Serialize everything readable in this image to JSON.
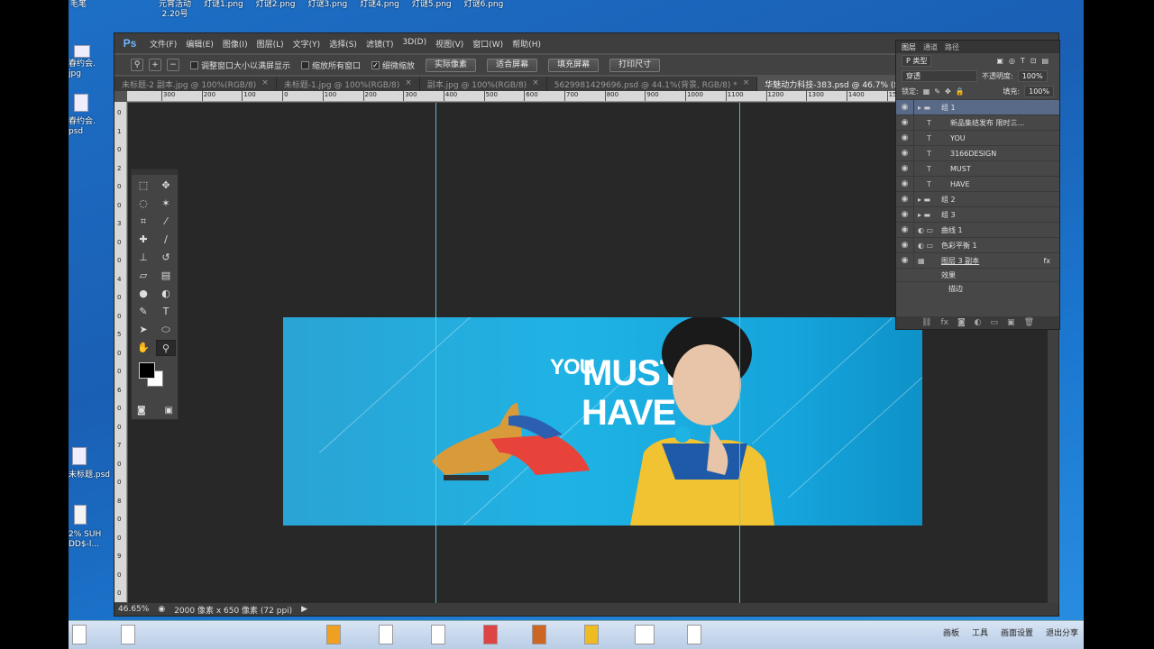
{
  "desktop": {
    "top_files": [
      "元宵活动\n2.20号",
      "灯谜1.png",
      "灯谜2.png",
      "灯谜3.png",
      "灯谜4.png",
      "灯谜5.png",
      "灯谜6.png"
    ],
    "left_labels": {
      "l1": "毛笔",
      "l2": "春约会.\njpg",
      "l3": "春约会.\npsd",
      "l4": "未标题.psd",
      "l5": "2% SUH\nDD$-l..."
    }
  },
  "ps": {
    "logo": "Ps",
    "menu": [
      "文件(F)",
      "编辑(E)",
      "图像(I)",
      "图层(L)",
      "文字(Y)",
      "选择(S)",
      "滤镜(T)",
      "3D(D)",
      "视图(V)",
      "窗口(W)",
      "帮助(H)"
    ],
    "options": {
      "resize_windows": "调整窗口大小以满屏显示",
      "zoom_all": "缩放所有窗口",
      "scrubby": "细微缩放",
      "btn_actual": "实际像素",
      "btn_fit": "适合屏幕",
      "btn_fill": "填充屏幕",
      "btn_print": "打印尺寸"
    },
    "tabs": [
      {
        "label": "未标题-2 副本.jpg @ 100%(RGB/8)",
        "active": false
      },
      {
        "label": "未标题-1.jpg @ 100%(RGB/8)",
        "active": false
      },
      {
        "label": "副本.jpg @ 100%(RGB/8)",
        "active": false
      },
      {
        "label": "5629981429696.psd @ 44.1%(背景, RGB/8) *",
        "active": false
      },
      {
        "label": "华魅动力科技-383.psd @ 46.7% (组 1, RGB/8) *",
        "active": true
      }
    ],
    "ruler_h": [
      "300",
      "200",
      "100",
      "0",
      "100",
      "200",
      "300",
      "400",
      "500",
      "600",
      "700",
      "800",
      "900",
      "1000",
      "1100",
      "1200",
      "1300",
      "1400",
      "1500",
      "1600",
      "1700",
      "1800",
      "1900"
    ],
    "ruler_v": [
      "0",
      "1",
      "0",
      "2",
      "0",
      "0",
      "3",
      "0",
      "0",
      "4",
      "0",
      "0",
      "5",
      "0",
      "0",
      "6",
      "0",
      "0",
      "7",
      "0",
      "0",
      "8",
      "0",
      "0",
      "9",
      "0",
      "0"
    ],
    "status": {
      "zoom": "46.65%",
      "doc": "2000 像素 x 650 像素 (72 ppi)"
    },
    "banner": {
      "you": "YOU",
      "must": "MUST",
      "have": "HAVE"
    }
  },
  "layers_panel": {
    "tabs": [
      "图层",
      "通道",
      "路径"
    ],
    "filter": "P 类型",
    "blend": "穿透",
    "opacity_label": "不透明度:",
    "opacity": "100%",
    "lock_label": "锁定:",
    "fill_label": "填充:",
    "fill": "100%",
    "layers": [
      {
        "name": "组 1",
        "kind": "group",
        "active": true
      },
      {
        "name": "新品集结发布 限时三...",
        "kind": "text"
      },
      {
        "name": "YOU",
        "kind": "text"
      },
      {
        "name": "3166DESIGN",
        "kind": "text"
      },
      {
        "name": "MUST",
        "kind": "text"
      },
      {
        "name": "HAVE",
        "kind": "text"
      },
      {
        "name": "组 2",
        "kind": "group"
      },
      {
        "name": "组 3",
        "kind": "group"
      },
      {
        "name": "曲线 1",
        "kind": "adjust"
      },
      {
        "name": "色彩平衡 1",
        "kind": "adjust"
      },
      {
        "name": "图层 3 副本",
        "kind": "image"
      }
    ],
    "effects": "效果",
    "stroke": "描边",
    "fx": "fx"
  },
  "taskbar": {
    "right": [
      "画板",
      "工具",
      "画面设置",
      "退出分享"
    ]
  }
}
